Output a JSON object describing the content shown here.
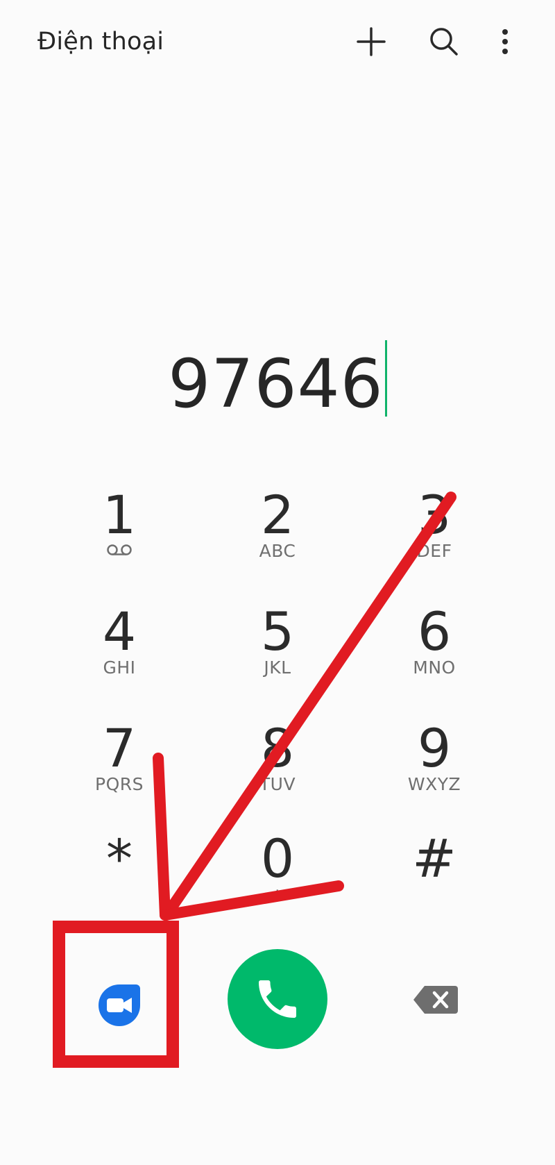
{
  "header": {
    "title": "Điện thoại",
    "add_icon": "plus-icon",
    "search_icon": "search-icon",
    "more_icon": "more-vertical-icon"
  },
  "dialer": {
    "number": "97646",
    "keys": [
      {
        "digit": "1",
        "letters": "",
        "icon": "voicemail-icon"
      },
      {
        "digit": "2",
        "letters": "ABC"
      },
      {
        "digit": "3",
        "letters": "DEF"
      },
      {
        "digit": "4",
        "letters": "GHI"
      },
      {
        "digit": "5",
        "letters": "JKL"
      },
      {
        "digit": "6",
        "letters": "MNO"
      },
      {
        "digit": "7",
        "letters": "PQRS"
      },
      {
        "digit": "8",
        "letters": "TUV"
      },
      {
        "digit": "9",
        "letters": "WXYZ"
      },
      {
        "digit": "*",
        "letters": ""
      },
      {
        "digit": "0",
        "letters": "+"
      },
      {
        "digit": "#",
        "letters": ""
      }
    ]
  },
  "actions": {
    "video_icon": "video-call-icon",
    "call_icon": "phone-icon",
    "backspace_icon": "backspace-icon"
  },
  "colors": {
    "call_button": "#00b96b",
    "video_button": "#1a73e8",
    "annotation": "#e11b22",
    "cursor": "#11b36b"
  }
}
